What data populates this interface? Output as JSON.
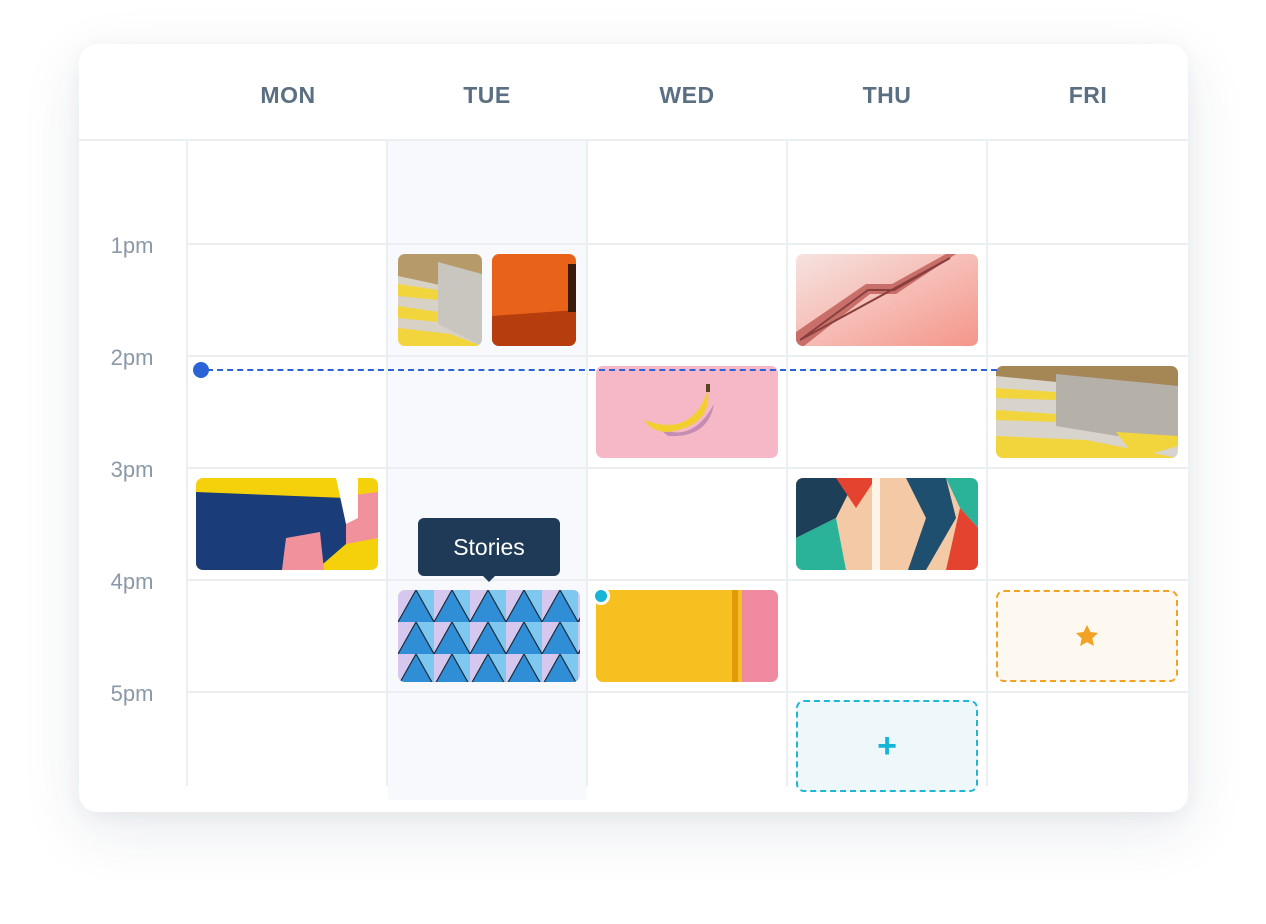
{
  "days": [
    "MON",
    "TUE",
    "WED",
    "THU",
    "FRI"
  ],
  "times": [
    "1pm",
    "2pm",
    "3pm",
    "4pm",
    "5pm"
  ],
  "tooltip": {
    "label": "Stories"
  },
  "add_slot": {
    "label": "+"
  },
  "colors": {
    "now_line": "#2b63d6",
    "tooltip_bg": "#1e3a56",
    "add_accent": "#16b4d6",
    "star_accent": "#f2a323",
    "today_column_bg": "#f7f9fc"
  },
  "icons": {
    "add": "plus-icon",
    "favorite": "star-icon"
  }
}
